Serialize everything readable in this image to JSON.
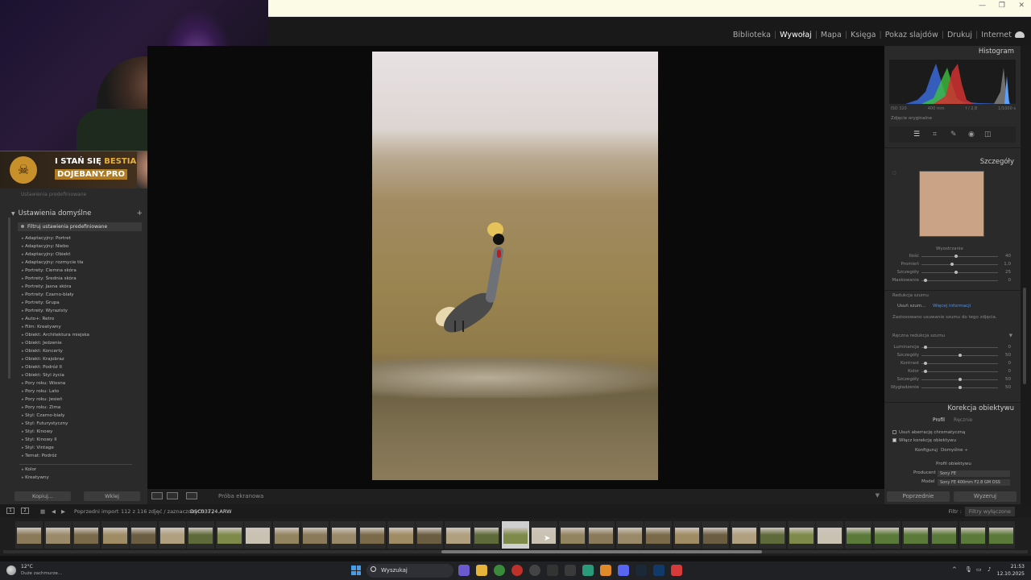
{
  "window": {
    "minimize": "—",
    "maximize": "❐",
    "close": "✕"
  },
  "modules": [
    "Biblioteka",
    "Wywołaj",
    "Mapa",
    "Księga",
    "Pokaz slajdów",
    "Drukuj",
    "Internet"
  ],
  "active_module": "Wywołaj",
  "overlay": {
    "badge_line1": "I STAŃ SIĘ",
    "badge_line1_accent": "BESTIA",
    "badge_line2": "DOJEBANY.PRO"
  },
  "left_panel": {
    "faded_top": "Ustawienia predefiniowane",
    "presets_header": "Ustawienia domyślne",
    "add": "+",
    "filter": "Filtruj ustawienia predefiniowane",
    "presets": [
      "Adaptacyjny: Portret",
      "Adaptacyjny: Niebo",
      "Adaptacyjny: Obiekt",
      "Adaptacyjny: rozmycie tła",
      "Portrety: Ciemna skóra",
      "Portrety: Średnia skóra",
      "Portrety: Jasna skóra",
      "Portrety: Czarno-biały",
      "Portrety: Grupa",
      "Portrety: Wyrazisty",
      "Auto+: Retro",
      "Film: Kreatywny",
      "Obiekt: Architektura miejska",
      "Obiekt: Jedzenie",
      "Obiekt: Koncerty",
      "Obiekt: Krajobraz",
      "Obiekt: Podróż II",
      "Obiekt: Styl życia",
      "Pory roku: Wiosna",
      "Pory roku: Lato",
      "Pory roku: Jesień",
      "Pory roku: Zima",
      "Styl: Czarno-biały",
      "Styl: Futurystyczny",
      "Styl: Kinowy",
      "Styl: Kinowy II",
      "Styl: Vintage",
      "Temat: Podróż"
    ],
    "user_presets": [
      "Kolor",
      "Kreatywny"
    ],
    "copy_button": "Kopiuj...",
    "paste_button": "Wklej"
  },
  "toolbar": {
    "soft_proof": "Próba ekranowa"
  },
  "right_panel": {
    "histogram_title": "Histogram",
    "histogram_info": [
      "ISO 320",
      "400 mm",
      "f / 2,8",
      "1/1000 s"
    ],
    "original_photo": "Zdjęcie oryginalne",
    "details_title": "Szczegóły",
    "sharpening": "Wyostrzanie",
    "sharpen_rows": [
      {
        "label": "Ilość",
        "value": "40",
        "pos": 0.45
      },
      {
        "label": "Promień",
        "value": "1,0",
        "pos": 0.4
      },
      {
        "label": "Szczegóły",
        "value": "25",
        "pos": 0.45
      },
      {
        "label": "Maskowanie",
        "value": "0",
        "pos": 0.05
      }
    ],
    "noise_reduction": "Redukcja szumu",
    "denoise_button": "Usuń szum...",
    "learn_more": "Więcej informacji",
    "applied_note": "Zastosowano usuwanie szumu do tego zdjęcia.",
    "manual_noise": "Ręczna redukcja szumu",
    "noise_rows": [
      {
        "label": "Luminancja",
        "value": "0",
        "pos": 0.05
      },
      {
        "label": "Szczegóły",
        "value": "50",
        "pos": 0.5
      },
      {
        "label": "Kontrast",
        "value": "0",
        "pos": 0.05
      },
      {
        "label": "Kolor",
        "value": "0",
        "pos": 0.05
      },
      {
        "label": "Szczegóły",
        "value": "50",
        "pos": 0.5
      },
      {
        "label": "Wygładzenie",
        "value": "50",
        "pos": 0.5
      }
    ],
    "lens_title": "Korekcja obiektywu",
    "tab_profile": "Profil",
    "tab_manual": "Ręcznie",
    "remove_ca": "Usuń aberrację chromatyczną",
    "enable_profile": "Włącz korekcję obiektywu",
    "config_label": "Konfiguruj",
    "config_value": "Domyślne ÷",
    "lens_profile": "Profil obiektywu",
    "maker_label": "Producent",
    "maker_value": "Sony FE",
    "model_label": "Model",
    "model_value": "Sony FE 400mm F2.8 GM OSS",
    "prev_button": "Poprzednie",
    "reset_button": "Wyzeruj"
  },
  "filmstrip": {
    "source": "Poprzedni import",
    "count": "112 z 116 zdjęć / zaznaczonych: 1 /",
    "filename": "DSC03724.ARW",
    "filter_label": "Filtr :",
    "filter_value": "Filtry wyłączone"
  },
  "taskbar": {
    "temp": "12°C",
    "weather": "Duże zachmurze...",
    "search": "Wyszukaj",
    "time": "21:53",
    "date": "12.10.2025"
  },
  "colors": {
    "accent": "#5a8fd8",
    "panel": "#2a2a2a",
    "background": "#0a0a0a"
  }
}
